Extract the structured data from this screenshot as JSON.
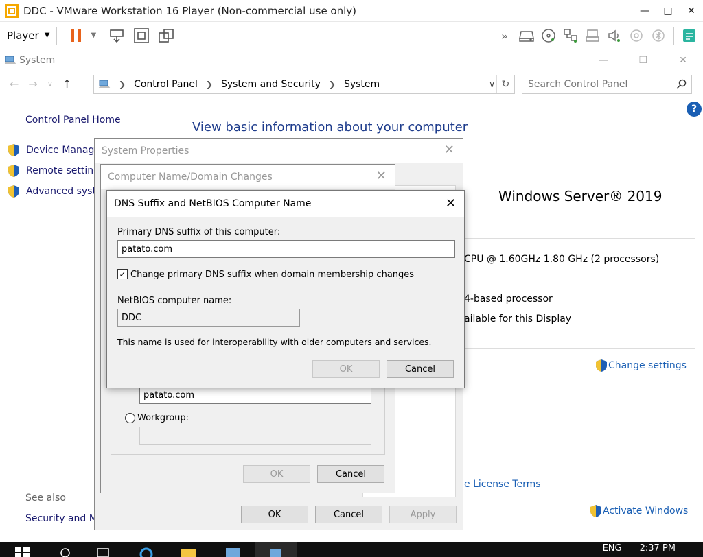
{
  "vmware": {
    "title": "DDC - VMware Workstation 16 Player (Non-commercial use only)",
    "player_menu": "Player"
  },
  "guest": {
    "window_title": "System",
    "breadcrumbs": [
      "Control Panel",
      "System and Security",
      "System"
    ],
    "search_placeholder": "Search Control Panel",
    "left_panel": {
      "home": "Control Panel Home",
      "links": [
        "Device Manage",
        "Remote setting",
        "Advanced syste"
      ]
    },
    "heading": "View basic information about your computer",
    "edition": "Windows Server® 2019",
    "processor": "CPU @ 1.60GHz   1.80 GHz  (2 processors)",
    "system_type": "4-based processor",
    "pen_touch": "ailable for this Display",
    "change_settings": "Change settings",
    "license_terms": "e License Terms",
    "activate": "Activate Windows",
    "see_also": "See also",
    "security_link": "Security and Ma"
  },
  "system_properties": {
    "title": "System Properties",
    "ok": "OK",
    "cancel": "Cancel",
    "apply": "Apply"
  },
  "name_changes": {
    "title": "Computer Name/Domain Changes",
    "domain_value": "patato.com",
    "workgroup_label": "Workgroup:",
    "workgroup_value": "",
    "ok": "OK",
    "cancel": "Cancel"
  },
  "dns_dialog": {
    "title": "DNS Suffix and NetBIOS Computer Name",
    "primary_label": "Primary DNS suffix of this computer:",
    "primary_value": "patato.com",
    "checkbox_label": "Change primary DNS suffix when domain membership changes",
    "checkbox_checked": true,
    "netbios_label": "NetBIOS computer name:",
    "netbios_value": "DDC",
    "info": "This name is used for interoperability with older computers and services.",
    "ok": "OK",
    "cancel": "Cancel"
  },
  "taskbar": {
    "lang": "ENG",
    "time": "2:37 PM"
  }
}
